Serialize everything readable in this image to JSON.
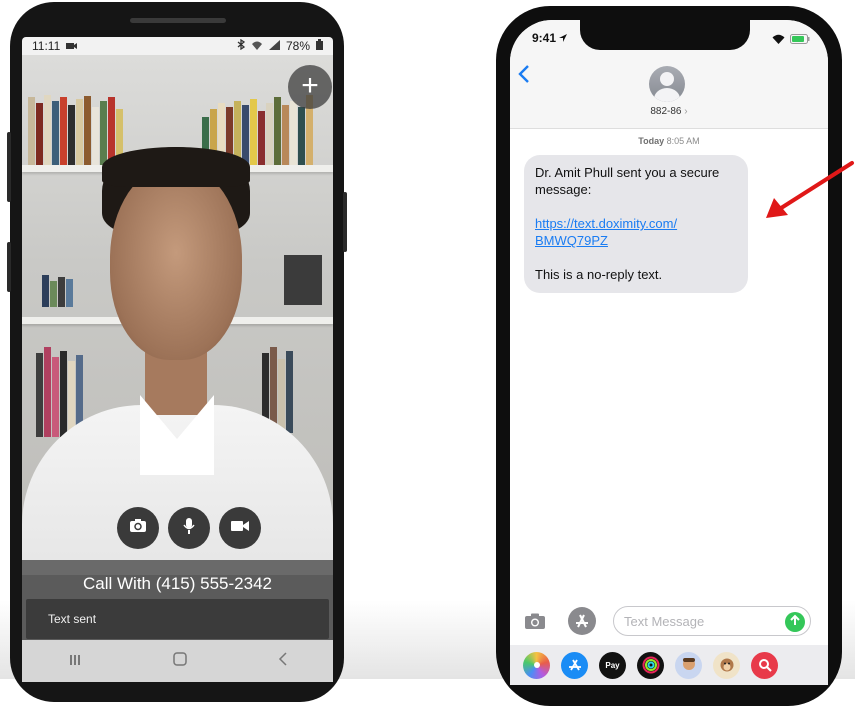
{
  "android": {
    "status": {
      "time": "11:11",
      "battery": "78%"
    },
    "call_title": "Call With (415) 555-2342",
    "toast": "Text sent"
  },
  "iphone": {
    "status_time": "9:41",
    "contact_number": "882-86",
    "timestamp_day": "Today",
    "timestamp_time": "8:05 AM",
    "message": {
      "line1": "Dr. Amit Phull sent you a secure message:",
      "link": "https://text.doximity.com/ BMWQ79PZ",
      "line3": "This is a no-reply text."
    },
    "input_placeholder": "Text Message",
    "apple_pay_label": "Pay"
  },
  "colors": {
    "ios_blue": "#1a7cf2",
    "send_green": "#34c759",
    "bubble_gray": "#e6e6ea",
    "annotation_red": "#e01818"
  },
  "icons": [
    "android-screenshot-icon",
    "bluetooth-icon",
    "wifi-icon",
    "signal-icon",
    "battery-icon",
    "plus-icon",
    "flip-camera-icon",
    "microphone-icon",
    "video-camera-icon",
    "recent-apps-icon",
    "home-icon",
    "back-icon",
    "ios-location-icon",
    "ios-wifi-icon",
    "ios-battery-icon",
    "chevron-left-icon",
    "contact-avatar-icon",
    "camera-icon",
    "app-store-icon",
    "send-arrow-icon",
    "photos-app-icon",
    "app-store-app-icon",
    "apple-pay-icon",
    "fitness-app-icon",
    "memoji-app-icon",
    "animoji-app-icon",
    "search-images-app-icon",
    "red-arrow-icon"
  ]
}
